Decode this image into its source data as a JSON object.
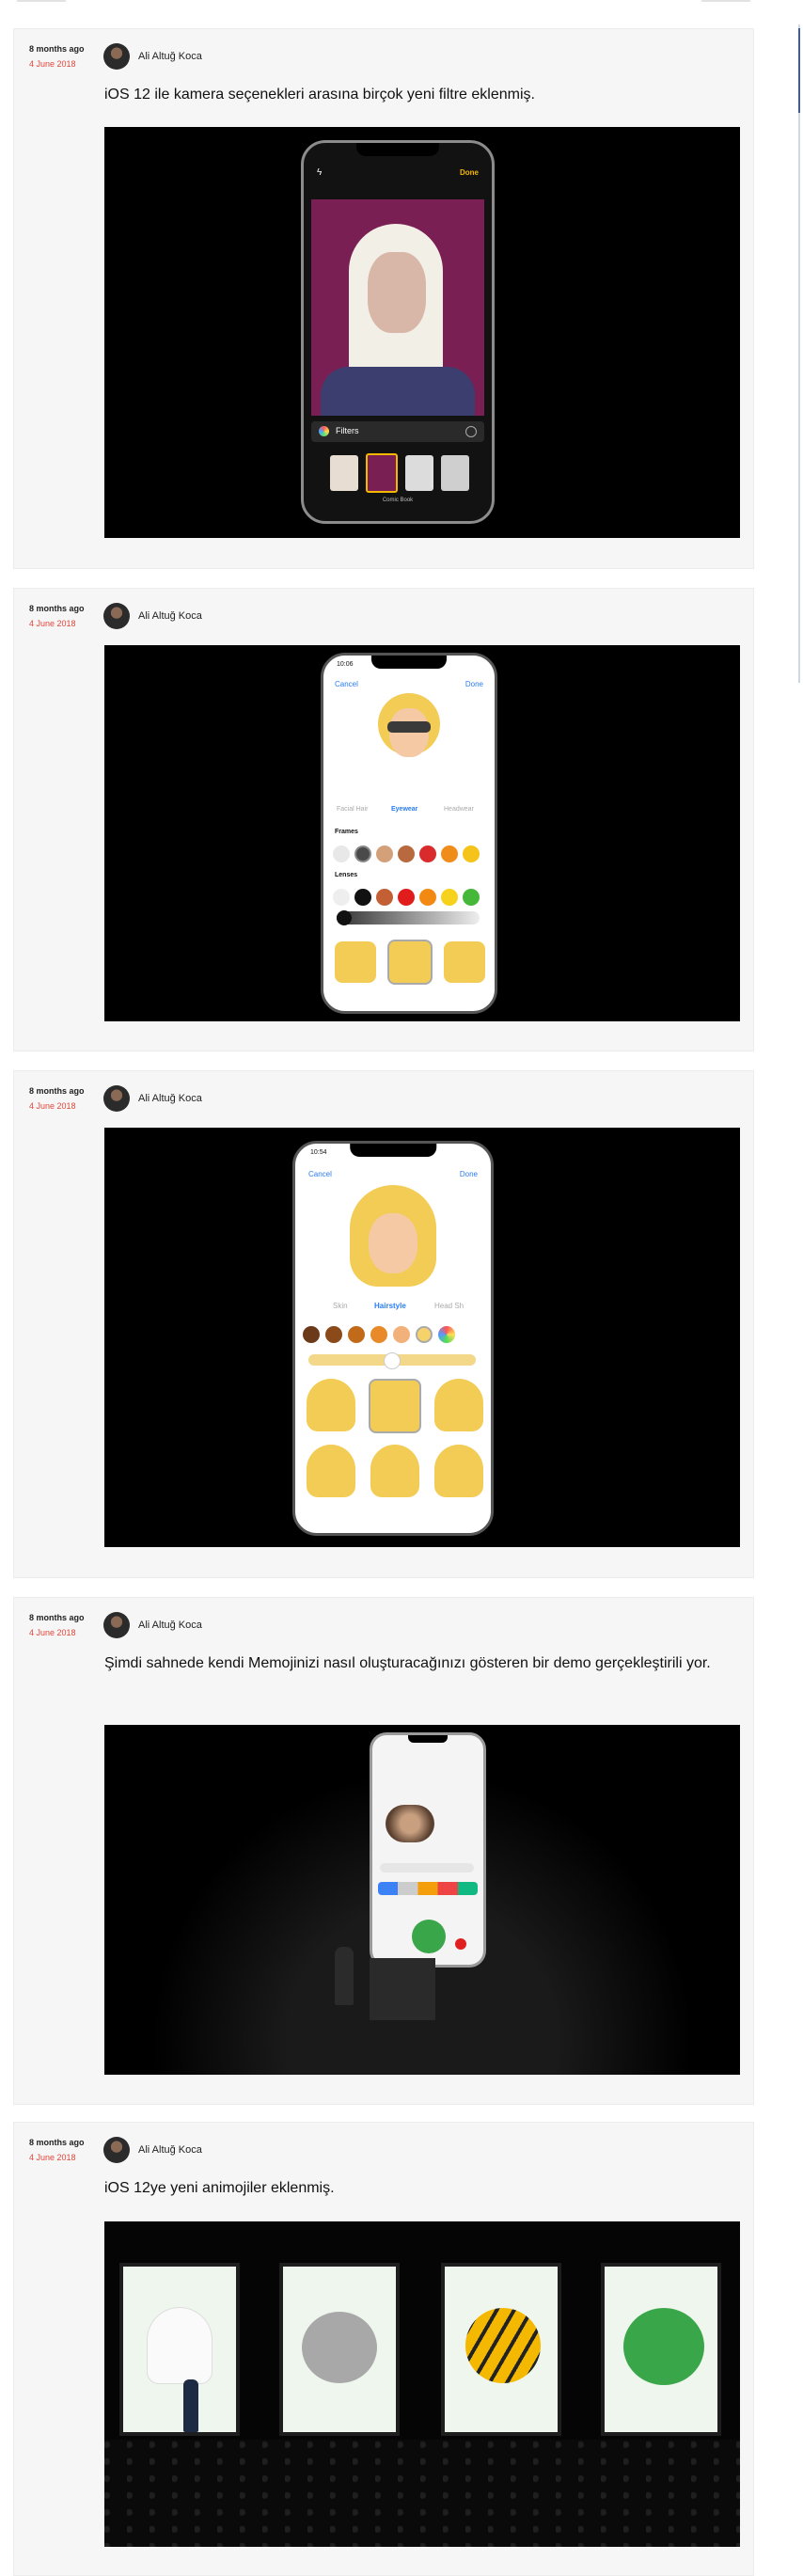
{
  "posts": [
    {
      "ago": "8 months ago",
      "date": "4 June 2018",
      "author": "Ali Altuğ Koca",
      "text": "iOS 12 ile kamera seçenekleri arasına birçok yeni filtre eklenmiş.",
      "screen": {
        "done": "Done",
        "filters": "Filters",
        "filter_name": "Comic Book"
      }
    },
    {
      "ago": "8 months ago",
      "date": "4 June 2018",
      "author": "Ali Altuğ Koca",
      "text": "",
      "screen": {
        "time": "10:06",
        "cancel": "Cancel",
        "done": "Done",
        "tabs": [
          "Facial Hair",
          "Eyewear",
          "Headwear"
        ],
        "frames": "Frames",
        "lenses": "Lenses"
      }
    },
    {
      "ago": "8 months ago",
      "date": "4 June 2018",
      "author": "Ali Altuğ Koca",
      "text": "",
      "screen": {
        "time": "10:54",
        "cancel": "Cancel",
        "done": "Done",
        "tabs": [
          "Skin",
          "Hairstyle",
          "Head Sh"
        ]
      }
    },
    {
      "ago": "8 months ago",
      "date": "4 June 2018",
      "author": "Ali Altuğ Koca",
      "text": "Şimdi sahnede kendi Memojinizi nasıl oluşturacağınızı gösteren bir demo gerçekleştirili yor."
    },
    {
      "ago": "8 months ago",
      "date": "4 June 2018",
      "author": "Ali Altuğ Koca",
      "text": "iOS 12ye yeni animojiler eklenmiş."
    }
  ],
  "colors": {
    "accent": "#2a7cf0",
    "date": "#e2463b",
    "gold": "#f5b800"
  }
}
